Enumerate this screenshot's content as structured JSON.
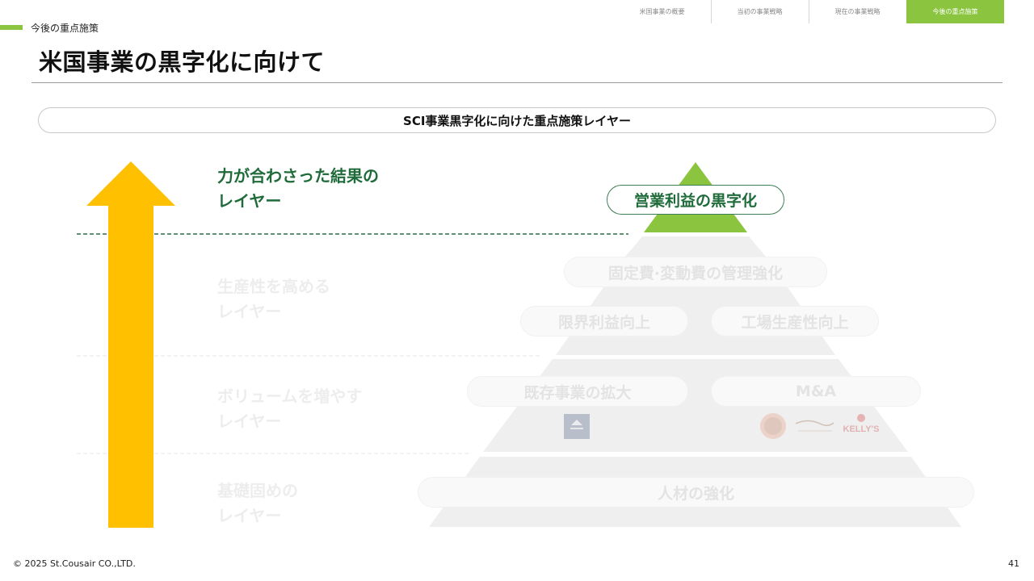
{
  "nav": {
    "tabs": [
      {
        "label": "米国事業の概要",
        "active": false
      },
      {
        "label": "当初の事業戦略",
        "active": false
      },
      {
        "label": "現在の事業戦略",
        "active": false
      },
      {
        "label": "今後の重点施策",
        "active": true
      }
    ]
  },
  "section_label": "今後の重点施策",
  "title": "米国事業の黒字化に向けて",
  "header_pill": "SCI事業黒字化に向けた重点施策レイヤー",
  "layers": [
    {
      "label": "力が合わさった結果の\nレイヤー",
      "state": "active"
    },
    {
      "label": "生産性を高める\nレイヤー",
      "state": "faded"
    },
    {
      "label": "ボリュームを増やす\nレイヤー",
      "state": "faded"
    },
    {
      "label": "基礎固めの\nレイヤー",
      "state": "faded"
    }
  ],
  "pyramid": {
    "apex": "営業利益の黒字化",
    "row2": "固定費·変動費の管理強化",
    "row3_left": "限界利益向上",
    "row3_right": "工場生産性向上",
    "row4_left": "既存事業の拡大",
    "row4_right": "M&A",
    "row5": "人材の強化",
    "brand_text": "KELLY'S"
  },
  "colors": {
    "accent_green": "#8bc53f",
    "dark_green": "#1f6b3a",
    "arrow_yellow": "#ffc000",
    "faded_gray": "#eeeeee"
  },
  "footer": {
    "copyright": "© 2025 St.Cousair CO.,LTD.",
    "page": "41"
  }
}
